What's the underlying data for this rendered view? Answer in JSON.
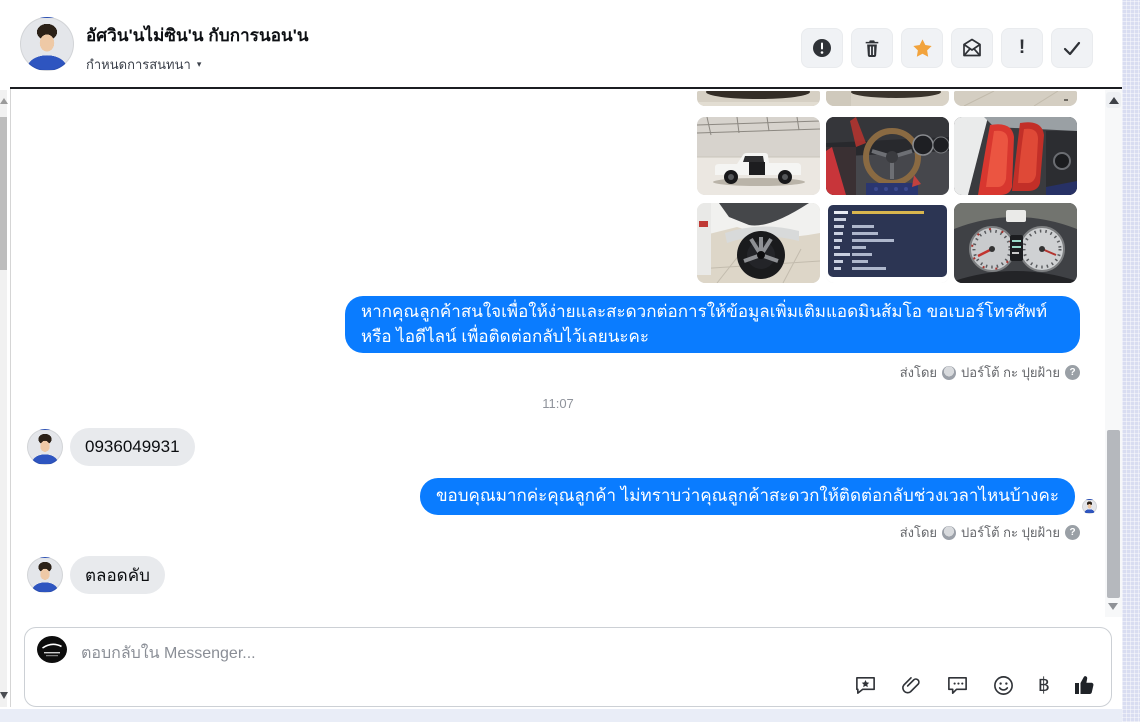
{
  "header": {
    "title": "อัศวิน'นไม่ซิน'น กับการนอน'น",
    "scheduler_label": "กำหนดการสนทนา",
    "scheduler_caret": "▾",
    "important_glyph": "!",
    "toolbar_icons": [
      "report-icon",
      "trash-icon",
      "star-icon",
      "mark-unread-icon",
      "exclamation-icon",
      "check-icon"
    ]
  },
  "conversation": {
    "timestamp": "11:07",
    "sent_by_label": "ส่งโดย",
    "sent_by_name": "ปอร์โต้ กะ ปุยฝ้าย",
    "help_glyph": "?",
    "messages": {
      "outgoing_1": "หากคุณลูกค้าสนใจเพื่อให้ง่ายและสะดวกต่อการให้ข้อมูลเพิ่มเติมแอดมินส้มโอ ขอเบอร์โทรศัพท์ หรือ ไอดีไลน์ เพื่อติดต่อกลับไว้เลยนะคะ",
      "incoming_1": "0936049931",
      "outgoing_2": "ขอบคุณมากค่ะคุณลูกค้า ไม่ทราบว่าคุณลูกค้าสะดวกให้ติดต่อกลับช่วงเวลาไหนบ้างคะ",
      "incoming_2": "ตลอดคับ"
    },
    "photo_names": [
      "car-floor-1",
      "car-floor-2",
      "car-floor-3",
      "truck-side-view",
      "steering-wheel-interior",
      "red-racing-seats",
      "front-wheel-closeup",
      "car-spec-sheet",
      "dashboard-gauges"
    ]
  },
  "composer": {
    "placeholder": "ตอบกลับใน Messenger...",
    "payment_symbol": "฿",
    "icon_names": [
      "saved-replies-icon",
      "attachment-icon",
      "comment-icon",
      "emoji-icon",
      "payment-icon",
      "like-icon"
    ]
  },
  "colors": {
    "bubble_blue": "#0a7cff",
    "bubble_gray": "#e8eaed",
    "star_orange": "#f2a33c",
    "edge_strip": "#d9ddf1",
    "icon_dark": "#2f3237",
    "meta_text": "#65676b"
  }
}
